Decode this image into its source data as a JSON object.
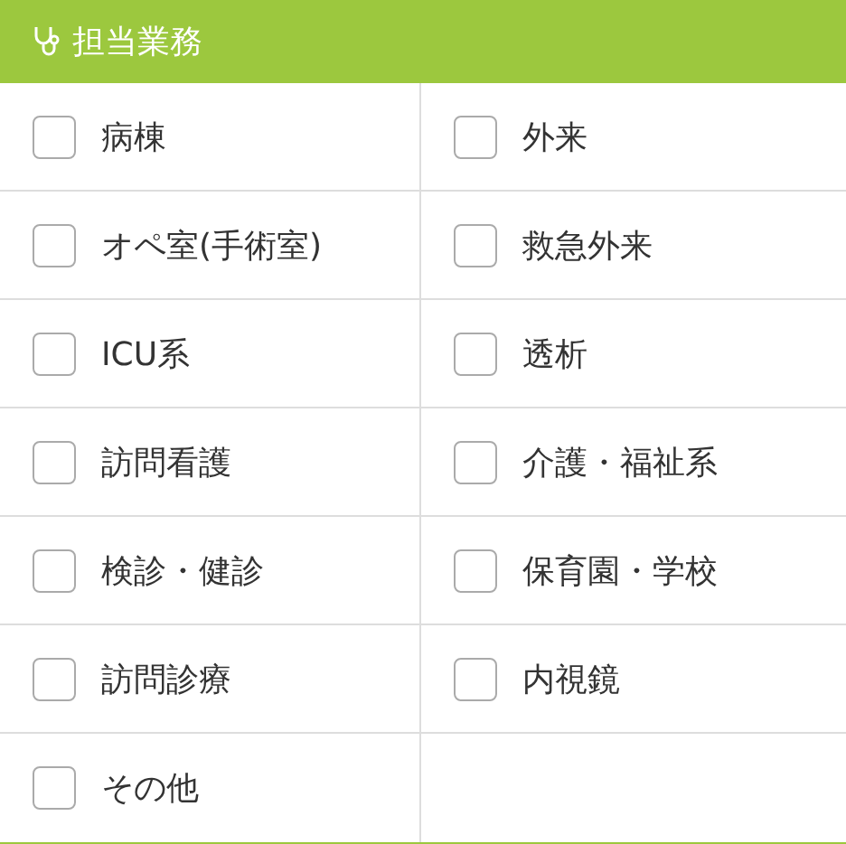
{
  "panel": {
    "title": "担当業務"
  },
  "options": [
    {
      "label": "病棟",
      "checked": false
    },
    {
      "label": "外来",
      "checked": false
    },
    {
      "label": "オペ室(手術室)",
      "checked": false
    },
    {
      "label": "救急外来",
      "checked": false
    },
    {
      "label": "ICU系",
      "checked": false
    },
    {
      "label": "透析",
      "checked": false
    },
    {
      "label": "訪問看護",
      "checked": false
    },
    {
      "label": "介護・福祉系",
      "checked": false
    },
    {
      "label": "検診・健診",
      "checked": false
    },
    {
      "label": "保育園・学校",
      "checked": false
    },
    {
      "label": "訪問診療",
      "checked": false
    },
    {
      "label": "内視鏡",
      "checked": false
    },
    {
      "label": "その他",
      "checked": false
    }
  ]
}
